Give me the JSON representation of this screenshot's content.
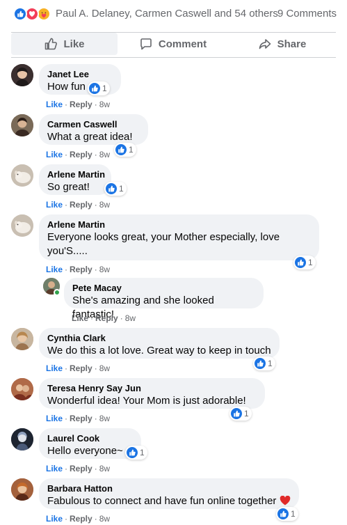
{
  "reactions_summary": {
    "icons": [
      "like-reaction-icon",
      "love-reaction-icon",
      "care-reaction-icon"
    ],
    "names": "Paul A. Delaney, Carmen Caswell and 54 others",
    "comments_count": "9 Comments"
  },
  "action_bar": {
    "like_label": "Like",
    "comment_label": "Comment",
    "share_label": "Share"
  },
  "comment_meta": {
    "like": "Like",
    "reply": "Reply",
    "separator": "·",
    "time": "8w"
  },
  "comments": [
    {
      "author": "Janet Lee",
      "text": "How fun",
      "reaction_count": "1",
      "avatar_color": "#4a3b3b"
    },
    {
      "author": "Carmen Caswell",
      "text": "What a great idea!",
      "reaction_count": "1",
      "avatar_color": "#6b5a4a"
    },
    {
      "author": "Arlene Martin",
      "text": "So great!",
      "reaction_count": "1",
      "avatar_color": "#d9cfc4"
    },
    {
      "author": "Arlene Martin",
      "text": "Everyone looks great, your Mother especially, love you'S.....",
      "reaction_count": "1",
      "avatar_color": "#d9cfc4"
    },
    {
      "author": "Pete Macay",
      "text": "She's amazing and she looked fantastic!",
      "reaction_count": "",
      "avatar_color": "#8a6d55"
    },
    {
      "author": "Cynthia Clark",
      "text": "We do this a lot love. Great way to keep in touch",
      "reaction_count": "1",
      "avatar_color": "#b08a66"
    },
    {
      "author": "Teresa Henry Say Jun",
      "text": "Wonderful idea! Your Mom is just adorable!",
      "reaction_count": "1",
      "avatar_color": "#a35a3a"
    },
    {
      "author": "Laurel Cook",
      "text": "Hello everyone~",
      "reaction_count": "1",
      "avatar_color": "#2d3340"
    },
    {
      "author": "Barbara Hatton",
      "text": "Fabulous to connect and have fun online together",
      "reaction_count": "1",
      "avatar_color": "#8c4a2a"
    }
  ],
  "colors": {
    "facebook_blue": "#1b74e4",
    "love_red": "#f33e58",
    "care_yellow": "#f7b125",
    "bubble_gray": "#f0f2f5",
    "meta_gray": "#65676b",
    "online_green": "#31a24c"
  }
}
